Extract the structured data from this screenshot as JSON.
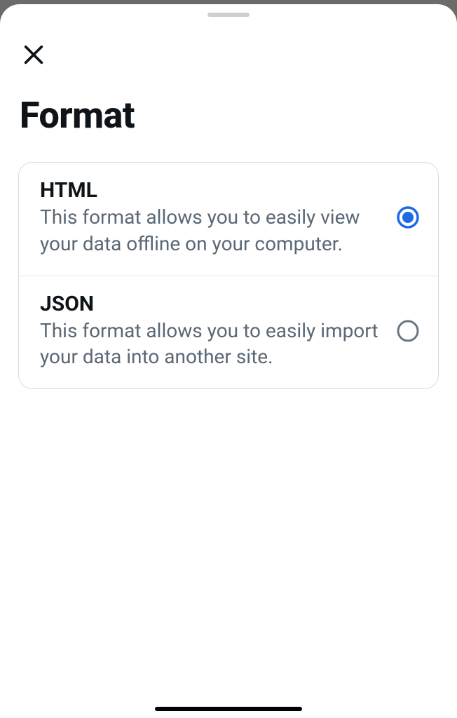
{
  "header": {
    "title": "Format"
  },
  "options": [
    {
      "id": "html",
      "title": "HTML",
      "description": "This format allows you to easily view your data offline on your computer.",
      "selected": true
    },
    {
      "id": "json",
      "title": "JSON",
      "description": "This format allows you to easily import your data into another site.",
      "selected": false
    }
  ],
  "colors": {
    "accent": "#1d6ae5",
    "radio_border": "#6b7683"
  }
}
